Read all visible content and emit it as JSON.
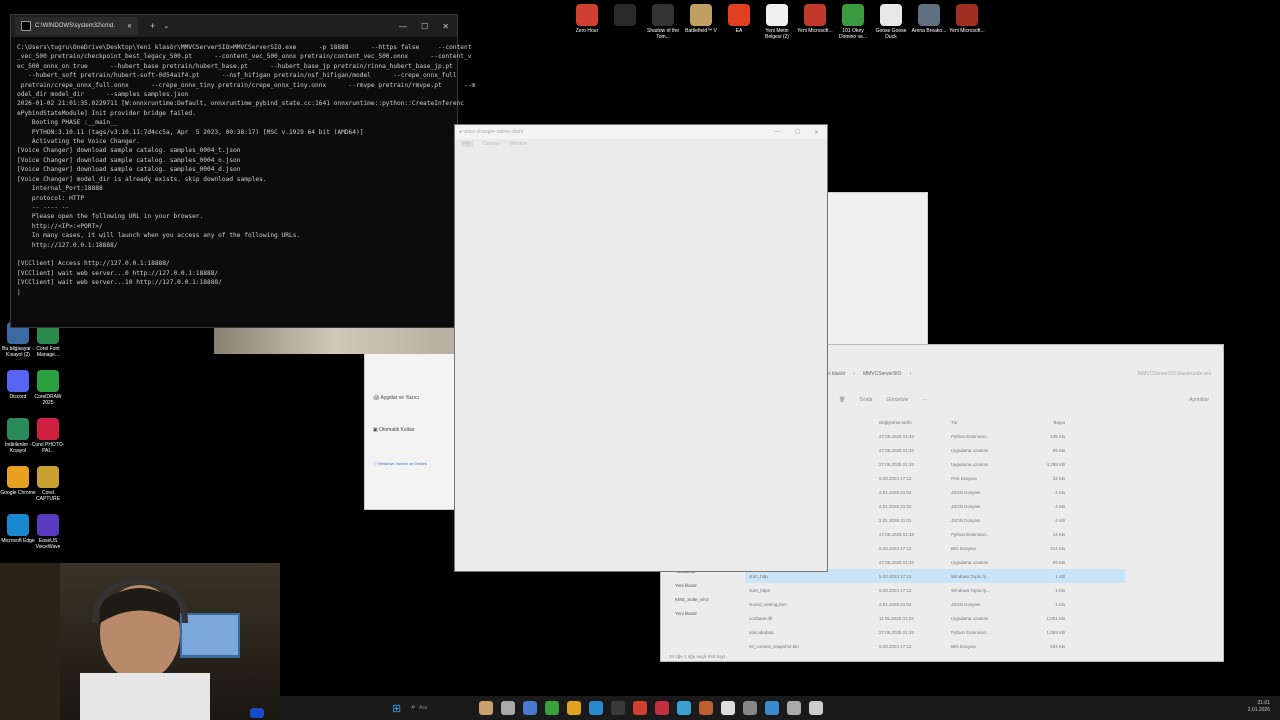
{
  "console": {
    "tab_title": "C:\\WINDOWS\\system32\\cmd.",
    "lines": [
      "C:\\Users\\tugru\\OneDrive\\Desktop\\Yeni klasör\\MMVCServerSIO>MMVCServerSIO.exe      -p 18888      --https false     --content",
      "_vec_500 pretrain/checkpoint_best_legacy_500.pt      --content_vec_500_onnx pretrain/content_vec_500.onnx      --content_v",
      "ec_500_onnx_on true      --hubert_base pretrain/hubert_base.pt      --hubert_base_jp pretrain/rinna_hubert_base_jp.pt",
      "   --hubert_soft pretrain/hubert-soft-0d54a1f4.pt      --nsf_hifigan pretrain/nsf_hifigan/model      --crepe_onnx_full",
      " pretrain/crepe_onnx_full.onnx      --crepe_onnx_tiny pretrain/crepe_onnx_tiny.onnx      --rmvpe pretrain/rmvpe.pt      --m",
      "odel_dir model_dir      --samples samples.json",
      "2026-01-02 21:01:35.0229711 [W:onnxruntime:Default, onnxruntime_pybind_state.cc:1641 onnxruntime::python::CreateInferenc",
      "ePybindStateModule] Init provider bridge failed.",
      "    Booting PHASE :__main__",
      "    PYTHON:3.10.11 (tags/v3.10.11:7d4cc5a, Apr  5 2023, 00:38:17) [MSC v.1929 64 bit (AMD64)]",
      "    Activating the Voice Changer.",
      "[Voice Changer] download sample catalog. samples_0004_t.json",
      "[Voice Changer] download sample catalog. samples_0004_o.json",
      "[Voice Changer] download sample catalog. samples_0004_d.json",
      "[Voice Changer] model_dir is already exists. skip download samples.",
      "    Internal_Port:18888",
      "    protocol: HTTP",
      "    -- ---- --",
      "    Please open the following URL in your browser.",
      "    http://<IP>:<PORT>/",
      "    In many cases, it will launch when you access any of the following URLs.",
      "    http://127.0.0.1:18888/",
      "",
      "[VCClient] Access http://127.0.0.1:18888/",
      "[VCClient] wait web server...0 http://127.0.0.1:18888/",
      "[VCClient] wait web server...10 http://127.0.0.1:18888/",
      "|"
    ]
  },
  "native_client": {
    "title": "voice-changer-native-client",
    "menu": [
      "File",
      "Display",
      "Window"
    ]
  },
  "explorer": {
    "breadcrumb": [
      "Yeni klasör",
      "MMVCServerSIO"
    ],
    "search_placeholder": "MMVCServerSIO klasöründe ara",
    "toolbar": [
      "Sırala",
      "Görüntüle"
    ],
    "details_label": "Ayrıntılar",
    "headers": [
      "",
      "Değiştirme tarihi",
      "Tür",
      "Boyut"
    ],
    "rows": [
      {
        "name": "",
        "date": "27.05.2025 01:33",
        "type": "Python Extension...",
        "size": "135 KB",
        "sel": false
      },
      {
        "name": "",
        "date": "27.05.2025 01:33",
        "type": "Uygulama uzantısı",
        "size": "65 KB",
        "sel": false
      },
      {
        "name": "",
        "date": "27.05.2025 01:33",
        "type": "Uygulama uzantısı",
        "size": "4.299 KB",
        "sel": false
      },
      {
        "name": "",
        "date": "5.03.2024 17:12",
        "type": "PAK Dosyası",
        "size": "32 KB",
        "sel": false
      },
      {
        "name": "",
        "date": "2.01.2026 21:01",
        "type": "JSON Dosyası",
        "size": "4 KB",
        "sel": false
      },
      {
        "name": "",
        "date": "2.01.2026 21:01",
        "type": "JSON Dosyası",
        "size": "4 KB",
        "sel": false
      },
      {
        "name": "",
        "date": "2.01.2026 21:01",
        "type": "JSON Dosyası",
        "size": "4 KB",
        "sel": false
      },
      {
        "name": "",
        "date": "27.05.2025 01:33",
        "type": "Python Extension...",
        "size": "14 KB",
        "sel": false
      },
      {
        "name": "",
        "date": "5.03.2024 17:12",
        "type": "BIN Dosyası",
        "size": "214 KB",
        "sel": false
      },
      {
        "name": "",
        "date": "27.05.2025 01:33",
        "type": "Uygulama uzantısı",
        "size": "59 KB",
        "sel": false
      },
      {
        "name": "start_http",
        "date": "5.03.2024 17:12",
        "type": "Windows Toplu İş...",
        "size": "1 KB",
        "sel": true
      },
      {
        "name": "start_https",
        "date": "5.03.2024 17:12",
        "type": "Windows Toplu İş...",
        "size": "1 KB",
        "sel": false
      },
      {
        "name": "stored_setting.json",
        "date": "2.01.2026 21:01",
        "type": "JSON Dosyası",
        "size": "1 KB",
        "sel": false
      },
      {
        "name": "ucrtbase.dll",
        "date": "11.05.2025 01:23",
        "type": "Uygulama uzantısı",
        "size": "1.001 KB",
        "sel": false
      },
      {
        "name": "unicodedata",
        "date": "27.05.2025 01:33",
        "type": "Python Extension...",
        "size": "1.069 KB",
        "sel": false
      },
      {
        "name": "v8_context_snapshot.bin",
        "date": "5.03.2024 17:12",
        "type": "BIN Dosyası",
        "size": "634 KB",
        "sel": false
      }
    ],
    "side_items": [
      "Yeni klasör",
      "KMS_Suite_v9.0",
      "Yeni klasör"
    ],
    "side_top": "Yakalanlar",
    "status": "34 öğe   1 öğe seçili  949 bayt"
  },
  "settings_panel": {
    "items": [
      {
        "title": "",
        "sub": ""
      },
      {
        "title": "Aygıtlar ve Yazıcı",
        "sub": ""
      },
      {
        "title": "Otomatik Kullan",
        "sub": ""
      },
      {
        "title": "Windows Yardım ve Destek",
        "sub": ""
      }
    ]
  },
  "desktop": {
    "top_icons": [
      {
        "label": "Zero Hour",
        "color": "#d04030"
      },
      {
        "label": "",
        "color": "#2a2a2a"
      },
      {
        "label": "Shadow of the Tom...",
        "color": "#333"
      },
      {
        "label": "Battlefield™ V",
        "color": "#c0a060"
      },
      {
        "label": "EA",
        "color": "#e04020"
      },
      {
        "label": "Yeni Metin Belgesi (2)",
        "color": "#f0f0f0"
      },
      {
        "label": "Yeni Microsoft...",
        "color": "#c0392b"
      },
      {
        "label": "101 Okey Domino ve...",
        "color": "#3a9a40"
      },
      {
        "label": "Goose Goose Duck",
        "color": "#e8e8e8"
      },
      {
        "label": "Arena Breako...",
        "color": "#607080"
      },
      {
        "label": "Yeni Microsoft...",
        "color": "#a03020"
      }
    ],
    "left_icons": [
      {
        "label": "Bu bilgisayar - Kısayol (2)",
        "color": "#3a6aa0"
      },
      {
        "label": "Corel Font Manage...",
        "color": "#2a8a4a"
      },
      {
        "label": "Discord",
        "color": "#5865f2"
      },
      {
        "label": "CorelDRAW 2025",
        "color": "#2aa040"
      },
      {
        "label": "İndirilenler - Kısayol",
        "color": "#2a8a5a"
      },
      {
        "label": "Corel PHOTO-PAI...",
        "color": "#d02040"
      },
      {
        "label": "Google Chrome",
        "color": "#e8a020"
      },
      {
        "label": "Corel CAPTURE",
        "color": "#c8a030"
      },
      {
        "label": "Microsoft Edge",
        "color": "#1a8ad0"
      },
      {
        "label": "EaseUS VoiceWave",
        "color": "#5a3ac0"
      }
    ]
  },
  "taskbar": {
    "search": "Ara",
    "time": "21:01",
    "date": "2.01.2026"
  }
}
